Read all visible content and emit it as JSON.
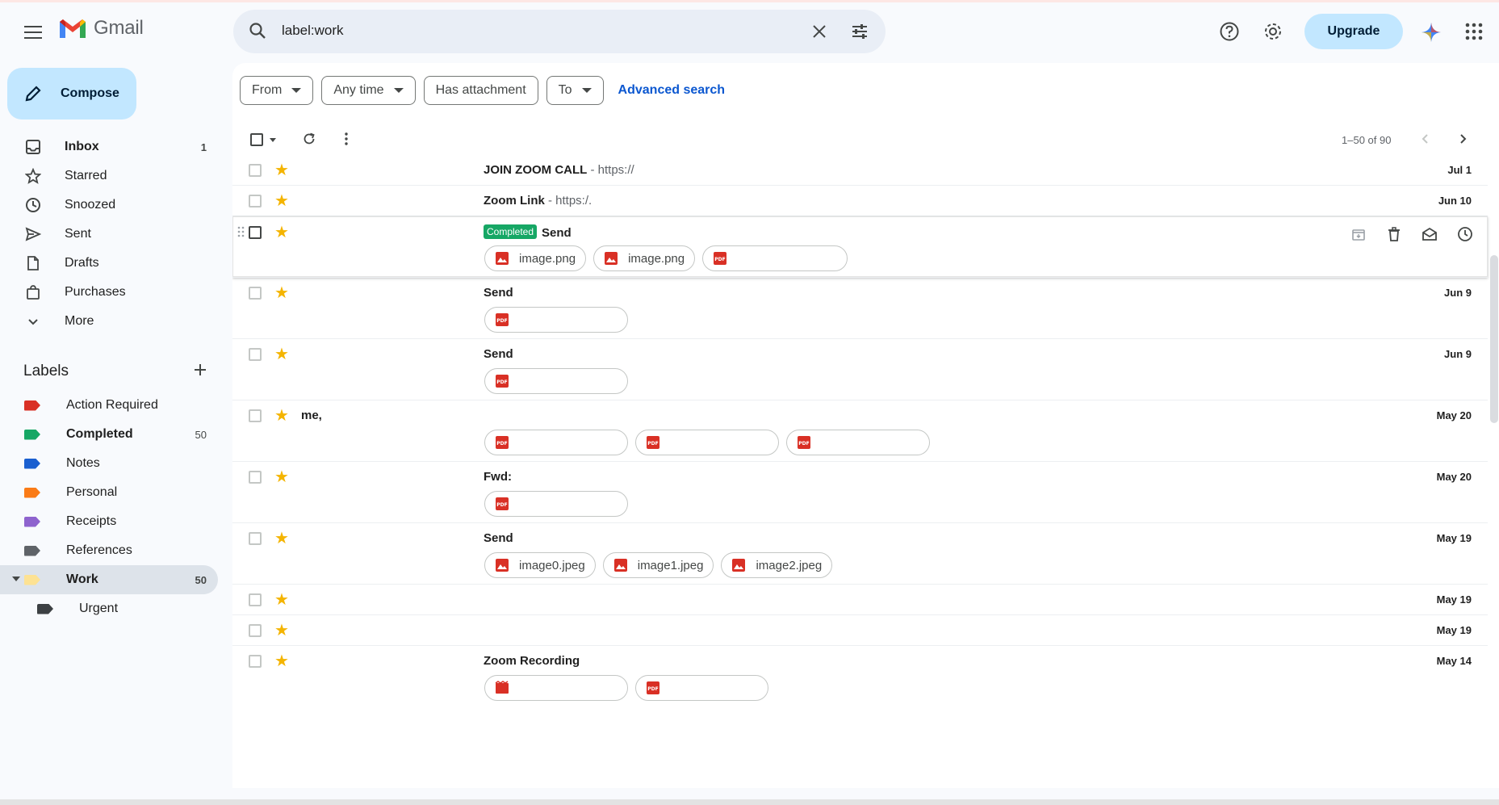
{
  "app": {
    "name": "Gmail"
  },
  "search": {
    "query": "label:work"
  },
  "header": {
    "upgrade_label": "Upgrade"
  },
  "compose": {
    "label": "Compose"
  },
  "nav": [
    {
      "label": "Inbox",
      "count": "1",
      "icon": "inbox-icon",
      "bold": true
    },
    {
      "label": "Starred",
      "count": "",
      "icon": "star-outline-icon"
    },
    {
      "label": "Snoozed",
      "count": "",
      "icon": "clock-icon"
    },
    {
      "label": "Sent",
      "count": "",
      "icon": "send-icon"
    },
    {
      "label": "Drafts",
      "count": "",
      "icon": "draft-icon"
    },
    {
      "label": "Purchases",
      "count": "",
      "icon": "bag-icon"
    },
    {
      "label": "More",
      "count": "",
      "icon": "chevron-down-icon"
    }
  ],
  "labels": {
    "header": "Labels",
    "items": [
      {
        "label": "Action Required",
        "count": "",
        "color": "#d93025"
      },
      {
        "label": "Completed",
        "count": "50",
        "color": "#16a765"
      },
      {
        "label": "Notes",
        "count": "",
        "color": "#1a5fd0"
      },
      {
        "label": "Personal",
        "count": "",
        "color": "#fa7b17"
      },
      {
        "label": "Receipts",
        "count": "",
        "color": "#8e63ce"
      },
      {
        "label": "References",
        "count": "",
        "color": "#5f6368"
      },
      {
        "label": "Work",
        "count": "50",
        "color": "#fde293"
      },
      {
        "label": "Urgent",
        "count": "",
        "color": "#3c4043"
      }
    ]
  },
  "filters": {
    "from": "From",
    "any_time": "Any time",
    "has_attachment": "Has attachment",
    "to": "To",
    "advanced": "Advanced search"
  },
  "pager": {
    "text": "1–50 of 90"
  },
  "emails": [
    {
      "sender": "",
      "subject": "JOIN ZOOM CALL",
      "snippet": " - https://",
      "date": "Jul 1"
    },
    {
      "sender": "",
      "subject": "Zoom Link",
      "snippet": " - https:/.",
      "date": "Jun 10"
    },
    {
      "sender": "",
      "badge": "Completed",
      "subject": "Send",
      "snippet": "",
      "date": "",
      "attachments": [
        {
          "name": "image.png",
          "type": "image"
        },
        {
          "name": "image.png",
          "type": "image"
        },
        {
          "name": "",
          "type": "pdf"
        }
      ]
    },
    {
      "sender": "",
      "subject": "Send",
      "snippet": "",
      "date": "Jun 9",
      "attachments": [
        {
          "name": "",
          "type": "pdf"
        }
      ]
    },
    {
      "sender": "",
      "subject": "Send",
      "snippet": "",
      "date": "Jun 9",
      "attachments": [
        {
          "name": "",
          "type": "pdf"
        }
      ]
    },
    {
      "sender": "me,",
      "subject": "",
      "snippet": "",
      "date": "May 20",
      "attachments": [
        {
          "name": "",
          "type": "pdf"
        },
        {
          "name": "",
          "type": "pdf"
        },
        {
          "name": "",
          "type": "pdf"
        }
      ]
    },
    {
      "sender": "",
      "subject": "Fwd:",
      "snippet": "",
      "date": "May 20",
      "attachments": [
        {
          "name": "",
          "type": "pdf"
        }
      ]
    },
    {
      "sender": "",
      "subject": "Send",
      "snippet": "",
      "date": "May 19",
      "attachments": [
        {
          "name": "image0.jpeg",
          "type": "image"
        },
        {
          "name": "image1.jpeg",
          "type": "image"
        },
        {
          "name": "image2.jpeg",
          "type": "image"
        }
      ]
    },
    {
      "sender": "",
      "subject": "",
      "snippet": "",
      "date": "May 19"
    },
    {
      "sender": "",
      "subject": "",
      "snippet": "",
      "date": "May 19"
    },
    {
      "sender": "",
      "subject": "Zoom Recording",
      "snippet": "",
      "date": "May 14",
      "attachments": [
        {
          "name": "",
          "type": "video"
        },
        {
          "name": "",
          "type": "pdf"
        }
      ]
    }
  ]
}
